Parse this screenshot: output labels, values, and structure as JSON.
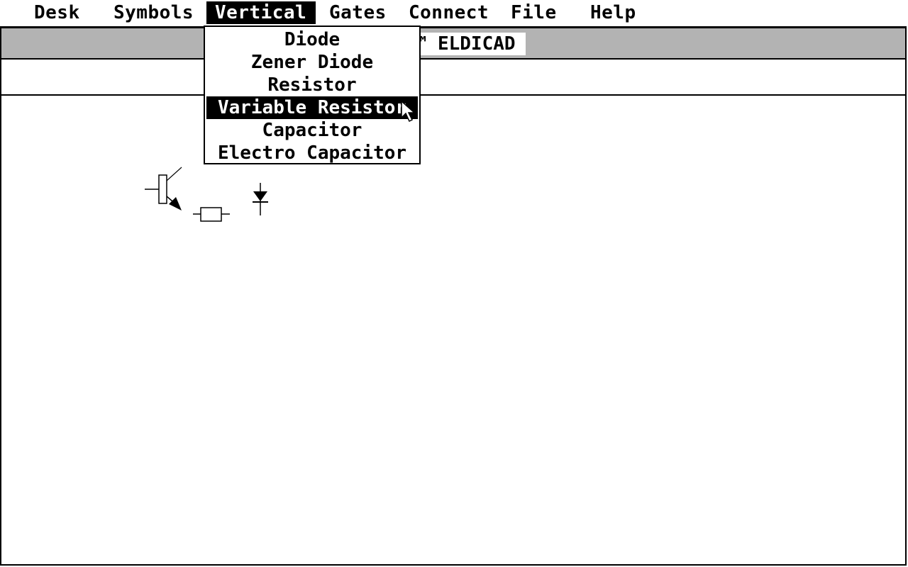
{
  "menubar": {
    "items": [
      {
        "label": "Desk"
      },
      {
        "label": "Symbols"
      },
      {
        "label": "Vertical"
      },
      {
        "label": "Gates"
      },
      {
        "label": "Connect"
      },
      {
        "label": "File"
      },
      {
        "label": "Help"
      }
    ],
    "active": "Vertical"
  },
  "window": {
    "title_visible": "S™ ELDICAD",
    "info_line": ""
  },
  "vertical_menu": {
    "items": [
      {
        "label": "Diode"
      },
      {
        "label": "Zener Diode"
      },
      {
        "label": "Resistor"
      },
      {
        "label": "Variable Resistor"
      },
      {
        "label": "Capacitor"
      },
      {
        "label": "Electro Capacitor"
      }
    ],
    "selected": "Variable Resistor"
  },
  "canvas": {
    "symbols": [
      {
        "type": "variable-resistor-icon"
      },
      {
        "type": "resistor-icon"
      },
      {
        "type": "diode-icon"
      }
    ]
  },
  "colors": {
    "foreground": "#000000",
    "background": "#ffffff"
  }
}
